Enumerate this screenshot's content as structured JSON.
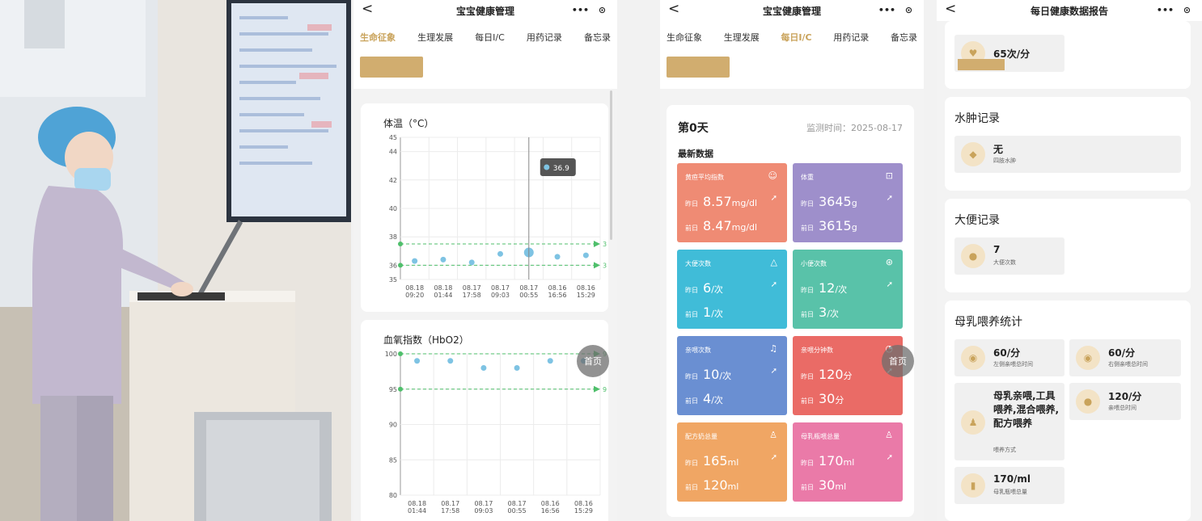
{
  "p1": {
    "title": "宝宝健康管理",
    "back": "<",
    "capsule_dots": "•••",
    "capsule_target": "⊙",
    "tabs": [
      "生命征象",
      "生理发展",
      "每日I/C",
      "用药记录",
      "备忘录"
    ],
    "active_tab": "生命征象",
    "home": "首页",
    "chart1": {
      "title": "体温（°C）",
      "ytick_labels": [
        "45",
        "44",
        "42",
        "40",
        "38",
        "36",
        "35"
      ],
      "xtick_dates": [
        "08.18",
        "08.18",
        "08.17",
        "08.17",
        "08.17",
        "08.16",
        "08.16"
      ],
      "xtick_times": [
        "09:20",
        "01:44",
        "17:58",
        "09:03",
        "00:55",
        "16:56",
        "15:29"
      ],
      "tooltip": "36.9",
      "ref_end_label": "3"
    },
    "chart2": {
      "title": "血氧指数（HbO2）",
      "ytick_labels": [
        "100",
        "95",
        "90",
        "85",
        "80"
      ],
      "xtick_dates": [
        "08.18",
        "08.17",
        "08.17",
        "08.17",
        "08.16",
        "08.16"
      ],
      "xtick_times": [
        "01:44",
        "17:58",
        "09:03",
        "00:55",
        "16:56",
        "15:29"
      ],
      "ref_end_label": "9"
    }
  },
  "chart_data": [
    {
      "type": "scatter",
      "title": "体温（°C）",
      "x": [
        "08.18 09:20",
        "08.18 01:44",
        "08.17 17:58",
        "08.17 09:03",
        "08.17 00:55",
        "08.16 16:56",
        "08.16 15:29"
      ],
      "series": [
        {
          "values": [
            36.3,
            36.4,
            36.2,
            36.8,
            36.9,
            36.6,
            36.7
          ]
        }
      ],
      "reference_lines": [
        37.5,
        36.0
      ],
      "ylim": [
        35,
        45
      ],
      "grid": true,
      "color": "#7ec3e3"
    },
    {
      "type": "scatter",
      "title": "血氧指数（HbO2）",
      "x": [
        "08.18 01:44",
        "08.17 17:58",
        "08.17 09:03",
        "08.17 00:55",
        "08.16 16:56",
        "08.16 15:29"
      ],
      "series": [
        {
          "values": [
            99,
            99,
            98,
            98,
            99,
            99
          ]
        }
      ],
      "reference_lines": [
        100,
        95
      ],
      "ylim": [
        80,
        100
      ],
      "grid": true,
      "color": "#7ec3e3"
    }
  ],
  "p2": {
    "title": "宝宝健康管理",
    "back": "<",
    "capsule_dots": "•••",
    "capsule_target": "⊙",
    "tabs": [
      "生命征象",
      "生理发展",
      "每日I/C",
      "用药记录",
      "备忘录"
    ],
    "active_tab": "每日I/C",
    "day": "第0天",
    "monitor_label": "监测时间：2025-08-17",
    "section": "最新数据",
    "home": "首页",
    "yesterday": "昨日",
    "daybefore": "前日",
    "tiles": [
      {
        "name": "黄疸平均指数",
        "icon": "☺",
        "color": "#ef8b74",
        "y_val": "8.57",
        "y_unit": "mg/dl",
        "d_val": "8.47",
        "d_unit": "mg/dl"
      },
      {
        "name": "体重",
        "icon": "⊡",
        "color": "#9e8fcb",
        "y_val": "3645",
        "y_unit": "g",
        "d_val": "3615",
        "d_unit": "g"
      },
      {
        "name": "大便次数",
        "icon": "△",
        "color": "#40bcd8",
        "y_val": "6",
        "y_unit": "/次",
        "d_val": "1",
        "d_unit": "/次"
      },
      {
        "name": "小便次数",
        "icon": "⊛",
        "color": "#59c2a9",
        "y_val": "12",
        "y_unit": "/次",
        "d_val": "3",
        "d_unit": "/次"
      },
      {
        "name": "亲喂次数",
        "icon": "♫",
        "color": "#6a8fd2",
        "y_val": "10",
        "y_unit": "/次",
        "d_val": "4",
        "d_unit": "/次"
      },
      {
        "name": "亲喂分钟数",
        "icon": "◔",
        "color": "#ea6b66",
        "y_val": "120",
        "y_unit": "分",
        "d_val": "30",
        "d_unit": "分"
      },
      {
        "name": "配方奶总量",
        "icon": "♙",
        "color": "#f0a664",
        "y_val": "165",
        "y_unit": "ml",
        "d_val": "120",
        "d_unit": "ml"
      },
      {
        "name": "母乳瓶喂总量",
        "icon": "♙",
        "color": "#ea7aa8",
        "y_val": "170",
        "y_unit": "ml",
        "d_val": "30",
        "d_unit": "ml"
      }
    ],
    "arrow": "➚"
  },
  "p3": {
    "title": "每日健康数据报告",
    "back": "<",
    "capsule_dots": "•••",
    "capsule_target": "⊙",
    "heart_value": "65次/分",
    "edema_title": "水肿记录",
    "edema_value": "无",
    "edema_sub": "四肢水肿",
    "stool_title": "大便记录",
    "stool_value": "7",
    "stool_sub": "大便次数",
    "bf_title": "母乳喂养统计",
    "left_value": "60/分",
    "left_sub": "左侧亲喂总时间",
    "right_value": "60/分",
    "right_sub": "右侧亲喂总时间",
    "method_value": "母乳亲喂,工具喂养,混合喂养,配方喂养",
    "method_sub": "喂养方式",
    "total_value": "120/分",
    "total_sub": "亲喂总时间",
    "bottle_value": "170/ml",
    "bottle_sub": "母乳瓶喂总量"
  },
  "colors": {
    "accent": "#c9a35b",
    "gold_button": "#d1ad6f",
    "ref_line": "#4fbf6b",
    "point": "#7ec3e3"
  }
}
